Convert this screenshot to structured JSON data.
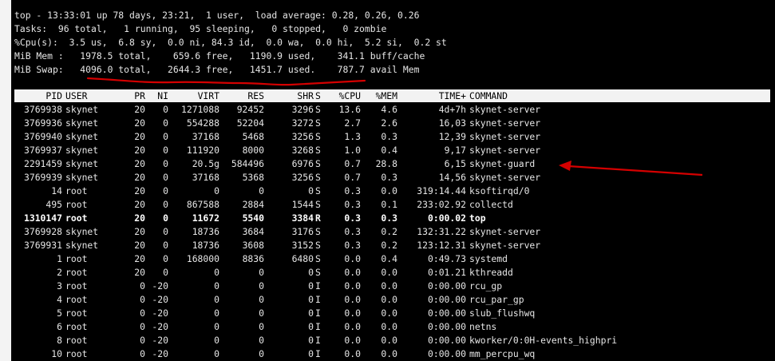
{
  "summary": {
    "line1": "top - 13:33:01 up 78 days, 23:21,  1 user,  load average: 0.28, 0.26, 0.26",
    "line2": "Tasks:  96 total,   1 running,  95 sleeping,   0 stopped,   0 zombie",
    "line3": "%Cpu(s):  3.5 us,  6.8 sy,  0.0 ni, 84.3 id,  0.0 wa,  0.0 hi,  5.2 si,  0.2 st",
    "line4": "MiB Mem :   1978.5 total,    659.6 free,   1190.9 used,    341.1 buff/cache",
    "line5": "MiB Swap:   4096.0 total,   2644.3 free,   1451.7 used.    787.7 avail Mem"
  },
  "columns": {
    "pid": "PID",
    "user": "USER",
    "pr": "PR",
    "ni": "NI",
    "virt": "VIRT",
    "res": "RES",
    "shr": "SHR",
    "s": "S",
    "cpu": "%CPU",
    "mem": "%MEM",
    "time": "TIME+",
    "command": "COMMAND"
  },
  "processes": [
    {
      "pid": "3769938",
      "user": "skynet",
      "pr": "20",
      "ni": "0",
      "virt": "1271088",
      "res": "92452",
      "shr": "3296",
      "s": "S",
      "cpu": "13.6",
      "mem": "4.6",
      "time": "4d+7h",
      "command": "skynet-server"
    },
    {
      "pid": "3769936",
      "user": "skynet",
      "pr": "20",
      "ni": "0",
      "virt": "554288",
      "res": "52204",
      "shr": "3272",
      "s": "S",
      "cpu": "2.7",
      "mem": "2.6",
      "time": "16,03",
      "command": "skynet-server"
    },
    {
      "pid": "3769940",
      "user": "skynet",
      "pr": "20",
      "ni": "0",
      "virt": "37168",
      "res": "5468",
      "shr": "3256",
      "s": "S",
      "cpu": "1.3",
      "mem": "0.3",
      "time": "12,39",
      "command": "skynet-server"
    },
    {
      "pid": "3769937",
      "user": "skynet",
      "pr": "20",
      "ni": "0",
      "virt": "111920",
      "res": "8000",
      "shr": "3268",
      "s": "S",
      "cpu": "1.0",
      "mem": "0.4",
      "time": "9,17",
      "command": "skynet-server"
    },
    {
      "pid": "2291459",
      "user": "skynet",
      "pr": "20",
      "ni": "0",
      "virt": "20.5g",
      "res": "584496",
      "shr": "6976",
      "s": "S",
      "cpu": "0.7",
      "mem": "28.8",
      "time": "6,15",
      "command": "skynet-guard"
    },
    {
      "pid": "3769939",
      "user": "skynet",
      "pr": "20",
      "ni": "0",
      "virt": "37168",
      "res": "5368",
      "shr": "3256",
      "s": "S",
      "cpu": "0.7",
      "mem": "0.3",
      "time": "14,56",
      "command": "skynet-server"
    },
    {
      "pid": "14",
      "user": "root",
      "pr": "20",
      "ni": "0",
      "virt": "0",
      "res": "0",
      "shr": "0",
      "s": "S",
      "cpu": "0.3",
      "mem": "0.0",
      "time": "319:14.44",
      "command": "ksoftirqd/0"
    },
    {
      "pid": "495",
      "user": "root",
      "pr": "20",
      "ni": "0",
      "virt": "867588",
      "res": "2884",
      "shr": "1544",
      "s": "S",
      "cpu": "0.3",
      "mem": "0.1",
      "time": "233:02.92",
      "command": "collectd"
    },
    {
      "pid": "1310147",
      "user": "root",
      "pr": "20",
      "ni": "0",
      "virt": "11672",
      "res": "5540",
      "shr": "3384",
      "s": "R",
      "cpu": "0.3",
      "mem": "0.3",
      "time": "0:00.02",
      "command": "top",
      "bold": true
    },
    {
      "pid": "3769928",
      "user": "skynet",
      "pr": "20",
      "ni": "0",
      "virt": "18736",
      "res": "3684",
      "shr": "3176",
      "s": "S",
      "cpu": "0.3",
      "mem": "0.2",
      "time": "132:31.22",
      "command": "skynet-server"
    },
    {
      "pid": "3769931",
      "user": "skynet",
      "pr": "20",
      "ni": "0",
      "virt": "18736",
      "res": "3608",
      "shr": "3152",
      "s": "S",
      "cpu": "0.3",
      "mem": "0.2",
      "time": "123:12.31",
      "command": "skynet-server"
    },
    {
      "pid": "1",
      "user": "root",
      "pr": "20",
      "ni": "0",
      "virt": "168000",
      "res": "8836",
      "shr": "6480",
      "s": "S",
      "cpu": "0.0",
      "mem": "0.4",
      "time": "0:49.73",
      "command": "systemd"
    },
    {
      "pid": "2",
      "user": "root",
      "pr": "20",
      "ni": "0",
      "virt": "0",
      "res": "0",
      "shr": "0",
      "s": "S",
      "cpu": "0.0",
      "mem": "0.0",
      "time": "0:01.21",
      "command": "kthreadd"
    },
    {
      "pid": "3",
      "user": "root",
      "pr": "0",
      "ni": "-20",
      "virt": "0",
      "res": "0",
      "shr": "0",
      "s": "I",
      "cpu": "0.0",
      "mem": "0.0",
      "time": "0:00.00",
      "command": "rcu_gp"
    },
    {
      "pid": "4",
      "user": "root",
      "pr": "0",
      "ni": "-20",
      "virt": "0",
      "res": "0",
      "shr": "0",
      "s": "I",
      "cpu": "0.0",
      "mem": "0.0",
      "time": "0:00.00",
      "command": "rcu_par_gp"
    },
    {
      "pid": "5",
      "user": "root",
      "pr": "0",
      "ni": "-20",
      "virt": "0",
      "res": "0",
      "shr": "0",
      "s": "I",
      "cpu": "0.0",
      "mem": "0.0",
      "time": "0:00.00",
      "command": "slub_flushwq"
    },
    {
      "pid": "6",
      "user": "root",
      "pr": "0",
      "ni": "-20",
      "virt": "0",
      "res": "0",
      "shr": "0",
      "s": "I",
      "cpu": "0.0",
      "mem": "0.0",
      "time": "0:00.00",
      "command": "netns"
    },
    {
      "pid": "8",
      "user": "root",
      "pr": "0",
      "ni": "-20",
      "virt": "0",
      "res": "0",
      "shr": "0",
      "s": "I",
      "cpu": "0.0",
      "mem": "0.0",
      "time": "0:00.00",
      "command": "kworker/0:0H-events_highpri"
    },
    {
      "pid": "10",
      "user": "root",
      "pr": "0",
      "ni": "-20",
      "virt": "0",
      "res": "0",
      "shr": "0",
      "s": "I",
      "cpu": "0.0",
      "mem": "0.0",
      "time": "0:00.00",
      "command": "mm_percpu_wq"
    }
  ],
  "colors": {
    "terminal_bg": "#000000",
    "terminal_fg": "#e6e6e6",
    "header_bg": "#f2f2f2",
    "annotation": "#d40000"
  }
}
